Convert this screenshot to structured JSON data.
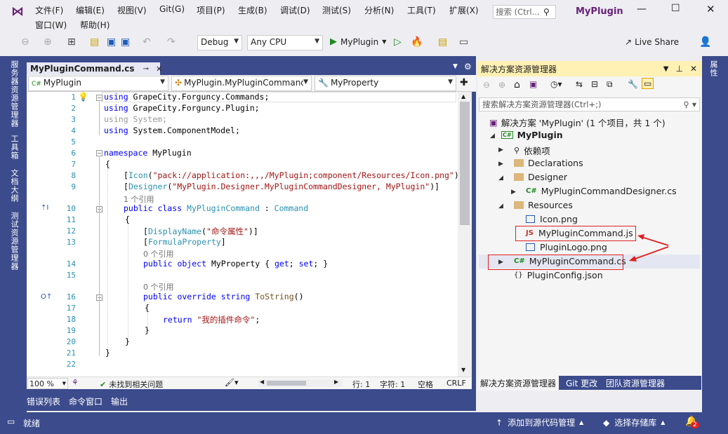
{
  "menu": [
    "文件(F)",
    "编辑(E)",
    "视图(V)",
    "Git(G)",
    "项目(P)",
    "生成(B)",
    "调试(D)",
    "测试(S)",
    "分析(N)",
    "工具(T)",
    "扩展(X)",
    "窗口(W)",
    "帮助(H)"
  ],
  "search": {
    "placeholder": "搜索 (Ctrl..."
  },
  "window_title": "MyPlugin",
  "toolbar": {
    "config": "Debug",
    "platform": "Any CPU",
    "start_label": "MyPlugin",
    "live_share": "Live Share"
  },
  "left_tabs": [
    "服务器资源管理器",
    "工具箱",
    "文档大纲",
    "测试资源管理器"
  ],
  "right_tabs": [
    "属性"
  ],
  "editor": {
    "tab_title": "MyPluginCommand.cs",
    "nav_project": "MyPlugin",
    "nav_type": "MyPlugin.MyPluginCommand",
    "nav_member": "MyProperty",
    "line_numbers": [
      "1",
      "2",
      "3",
      "4",
      "5",
      "6",
      "7",
      "8",
      "9",
      "10",
      "11",
      "12",
      "13",
      "14",
      "15",
      "16",
      "17",
      "18",
      "19",
      "20",
      "21",
      "22"
    ],
    "refs_1": "1 个引用",
    "refs_0a": "0 个引用",
    "refs_0b": "0 个引用",
    "zoom": "100 %",
    "issues": "未找到相关问题",
    "row": "行: 1",
    "col": "字符: 1",
    "ws": "空格",
    "eol": "CRLF"
  },
  "code": {
    "l1_kw": "using",
    "l1_rest": " GrapeCity.Forguncy.Commands;",
    "l2_kw": "using",
    "l2_rest": " GrapeCity.Forguncy.Plugin;",
    "l3": "using System;",
    "l4_kw": "using",
    "l4_rest": " System.ComponentModel;",
    "l6_kw": "namespace",
    "l6_rest": " MyPlugin",
    "brace_open": "{",
    "brace_close": "}",
    "l8_a": "[",
    "l8_b": "Icon",
    "l8_c": "(",
    "l8_d": "\"pack://application:,,,/MyPlugin;component/Resources/Icon.png\"",
    "l8_e": ")]",
    "l9_a": "[",
    "l9_b": "Designer",
    "l9_c": "(",
    "l9_d": "\"MyPlugin.Designer.MyPluginCommandDesigner, MyPlugin\"",
    "l9_e": ")]",
    "l10_a": "public class ",
    "l10_b": "MyPluginCommand",
    "l10_c": " : ",
    "l10_d": "Command",
    "l12_a": "[",
    "l12_b": "DisplayName",
    "l12_c": "(",
    "l12_d": "\"命令属性\"",
    "l12_e": ")]",
    "l13_a": "[",
    "l13_b": "FormulaProperty",
    "l13_c": "]",
    "l14_a": "public object ",
    "l14_b": "MyProperty { ",
    "l14_c": "get",
    "l14_d": "; ",
    "l14_e": "set",
    "l14_f": "; }",
    "l16_a": "public override string ",
    "l16_b": "ToString",
    "l16_c": "()",
    "l18_a": "return ",
    "l18_b": "\"我的插件命令\"",
    "l18_c": ";"
  },
  "bottom_tabs": [
    "错误列表",
    "命令窗口",
    "输出"
  ],
  "solution_explorer": {
    "title": "解决方案资源管理器",
    "search_placeholder": "搜索解决方案资源管理器(Ctrl+;)",
    "solution": "解决方案 'MyPlugin' (1 个项目，共 1 个)",
    "project": "MyPlugin",
    "items": [
      {
        "label": "依赖项"
      },
      {
        "label": "Declarations"
      },
      {
        "label": "Designer"
      },
      {
        "label": "MyPluginCommandDesigner.cs"
      },
      {
        "label": "Resources"
      },
      {
        "label": "Icon.png"
      },
      {
        "label": "MyPluginCommand.js"
      },
      {
        "label": "PluginLogo.png"
      },
      {
        "label": "MyPluginCommand.cs"
      },
      {
        "label": "PluginConfig.json"
      }
    ],
    "tabs": [
      "解决方案资源管理器",
      "Git 更改",
      "团队资源管理器"
    ]
  },
  "status": {
    "ready": "就绪",
    "source_control": "添加到源代码管理",
    "repo": "选择存储库",
    "notifications": "2"
  }
}
